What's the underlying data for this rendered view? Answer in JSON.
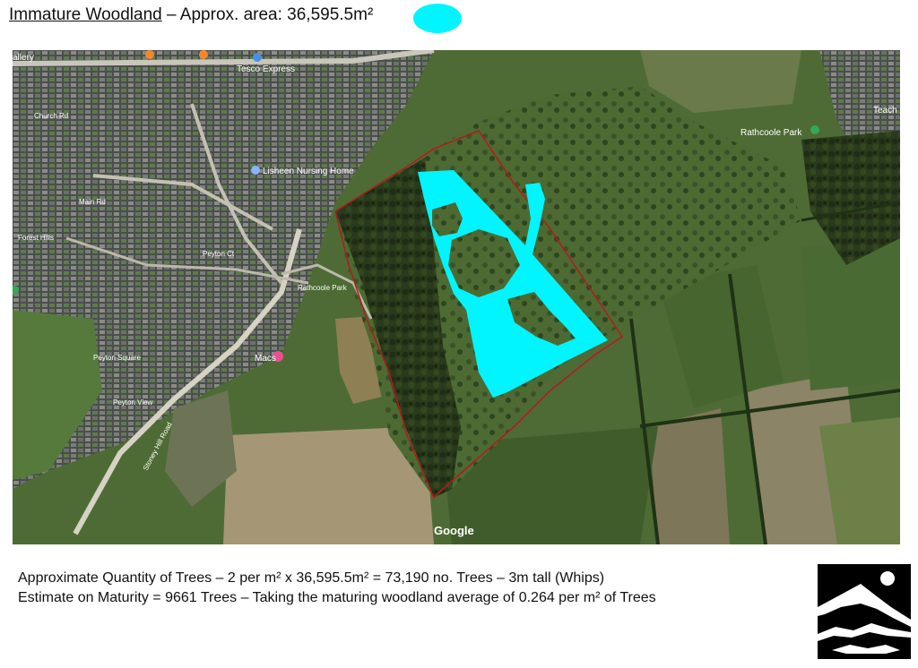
{
  "header": {
    "title_underlined": "Immature Woodland",
    "title_rest": " – Approx. area: 36,595.5m²"
  },
  "legend": {
    "fill_color": "#00f5ff"
  },
  "map": {
    "fill_color": "#00f5ff",
    "boundary_color": "#b31b1b",
    "labels": {
      "gallery": "allery",
      "tesco": "Tesco Express",
      "nursing_home": "Lisheen Nursing Home",
      "church_rd": "Church Rd",
      "main_rd": "Main Rd",
      "forest_hills": "Forest Hills",
      "peyton_ct": "Peyton Ct",
      "peyton_square": "Peyton Square",
      "peyton_view": "Peyton View",
      "rathcoole_park": "Rathcoole Park",
      "rathcoole_park_road": "Rathcoole Park",
      "macs": "Macs",
      "teach": "Teach",
      "stoney_hill_rd": "Stoney Hill Road",
      "google": "Google"
    }
  },
  "notes": {
    "line1": "Approximate Quantity of Trees – 2 per m² x   36,595.5m² = 73,190 no. Trees – 3m tall (Whips)",
    "line2": "Estimate on Maturity = 9661 Trees – Taking the maturing woodland average of 0.264 per m² of Trees"
  },
  "logo": {
    "icon": "mountain-moon-logo"
  }
}
